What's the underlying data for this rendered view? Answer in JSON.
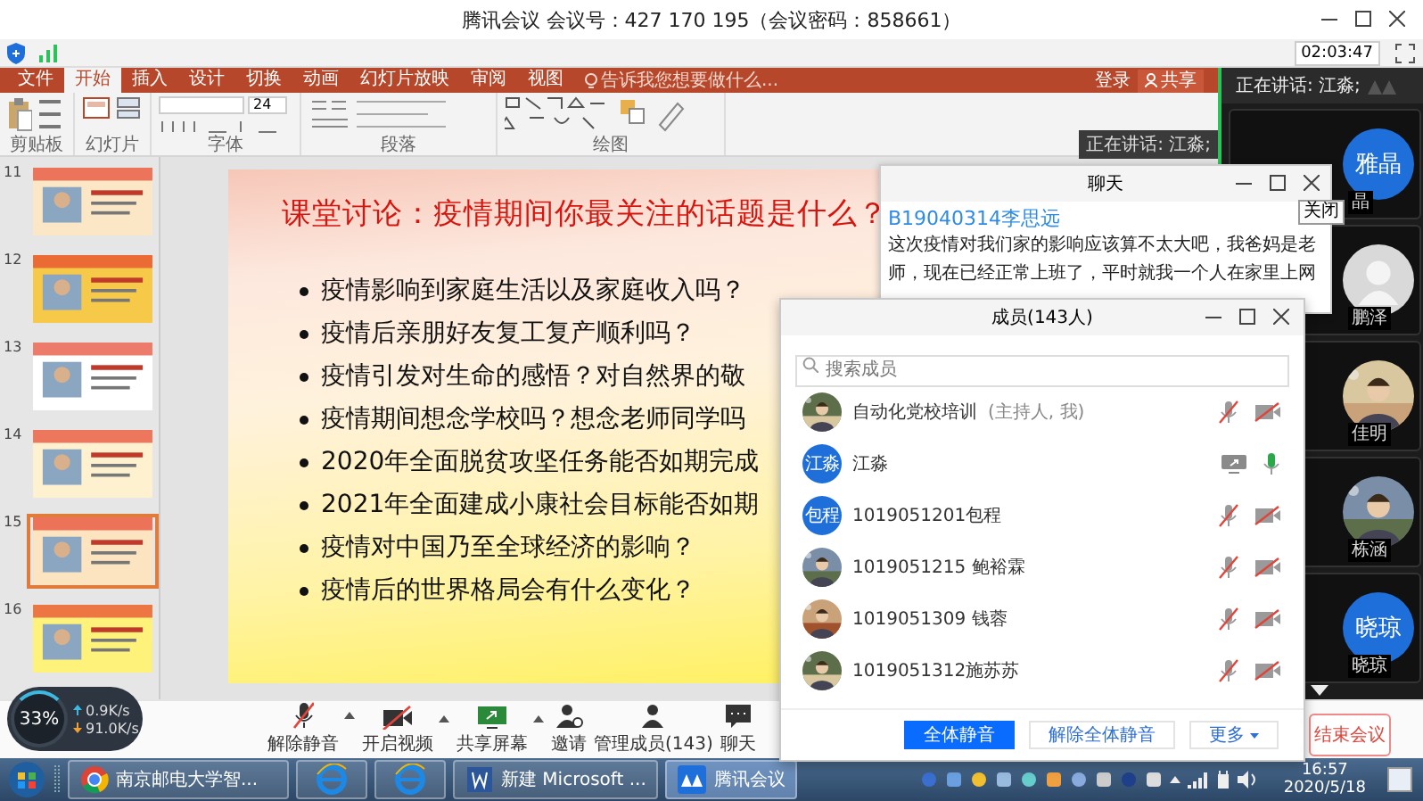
{
  "window": {
    "title": "腾讯会议 会议号：427 170 195（会议密码：858661）"
  },
  "timer": "02:03:47",
  "shared_screen": {
    "ribbon_tabs": [
      {
        "label": "文件",
        "selected": false
      },
      {
        "label": "开始",
        "selected": true
      },
      {
        "label": "插入",
        "selected": false
      },
      {
        "label": "设计",
        "selected": false
      },
      {
        "label": "切换",
        "selected": false
      },
      {
        "label": "动画",
        "selected": false
      },
      {
        "label": "幻灯片放映",
        "selected": false
      },
      {
        "label": "审阅",
        "selected": false
      },
      {
        "label": "视图",
        "selected": false
      }
    ],
    "ribbon_search": "告诉我您想要做什么...",
    "account": {
      "login": "登录",
      "share": "共享"
    },
    "font_size": "24",
    "ribbon_groups": [
      "剪贴板",
      "幻灯片",
      "字体",
      "段落",
      "绘图"
    ],
    "speaking_overlay": "正在讲话: 江淼;",
    "thumbnails": [
      {
        "number": "11",
        "selected": false
      },
      {
        "number": "12",
        "selected": false
      },
      {
        "number": "13",
        "selected": false
      },
      {
        "number": "14",
        "selected": false
      },
      {
        "number": "15",
        "selected": true
      },
      {
        "number": "16",
        "selected": false
      }
    ],
    "slide": {
      "title": "课堂讨论：疫情期间你最关注的话题是什么？",
      "bullets": [
        "疫情影响到家庭生活以及家庭收入吗？",
        "疫情后亲朋好友复工复产顺利吗？",
        "疫情引发对生命的感悟？对自然界的敬",
        "疫情期间想念学校吗？想念老师同学吗",
        "2020年全面脱贫攻坚任务能否如期完成",
        "2021年全面建成小康社会目标能否如期",
        "疫情对中国乃至全球经济的影响？",
        "疫情后的世界格局会有什么变化？"
      ]
    }
  },
  "participants": {
    "speaking": "正在讲话: 江淼;",
    "tiles": [
      {
        "name": "晶",
        "avatar": {
          "kind": "initials",
          "text": "雅晶"
        }
      },
      {
        "name": "鹏泽",
        "avatar": {
          "kind": "default"
        }
      },
      {
        "name": "佳明"
      },
      {
        "name": "栋涵"
      },
      {
        "name": "晓琼",
        "avatar": {
          "kind": "initials",
          "text": "晓琼"
        }
      }
    ]
  },
  "chat": {
    "title": "聊天",
    "tooltip": "关闭",
    "messages": [
      {
        "sender": "B19040314李思远",
        "text": "这次疫情对我们家的影响应该算不太大吧，我爸妈是老师，现在已经正常上班了，平时就我一个人在家里上网"
      }
    ]
  },
  "members": {
    "title": "成员(143人)",
    "search": {
      "placeholder": "搜索成员"
    },
    "rows": [
      {
        "name": "自动化党校培训",
        "role": "(主持人, 我)",
        "sharing": false,
        "mic_on": false,
        "camera_on": false
      },
      {
        "name": "江淼",
        "avatar": {
          "kind": "initials",
          "text": "江淼"
        },
        "sharing": true,
        "mic_on": true
      },
      {
        "name": "1019051201包程",
        "avatar": {
          "kind": "initials",
          "text": "包程"
        },
        "sharing": false,
        "mic_on": false,
        "camera_on": false
      },
      {
        "name": "1019051215 鲍裕霖",
        "sharing": false,
        "mic_on": false,
        "camera_on": false
      },
      {
        "name": "1019051309 钱蓉",
        "sharing": false,
        "mic_on": false,
        "camera_on": false
      },
      {
        "name": "1019051312施苏苏",
        "sharing": false,
        "mic_on": false,
        "camera_on": false
      }
    ],
    "buttons": [
      {
        "label": "全体静音",
        "kind": "primary"
      },
      {
        "label": "解除全体静音",
        "kind": "secondary"
      },
      {
        "label": "更多",
        "kind": "dropdown"
      }
    ]
  },
  "network": {
    "percent": "33%",
    "upload": "0.9K/s",
    "download": "91.0K/s"
  },
  "toolbar": {
    "buttons": [
      {
        "label": "解除静音",
        "kind": "mic_off",
        "caret": true
      },
      {
        "label": "开启视频",
        "kind": "video_off",
        "caret": true
      },
      {
        "label": "共享屏幕",
        "kind": "share",
        "caret": true
      },
      {
        "label": "邀请",
        "kind": "invite",
        "caret": false
      },
      {
        "label": "管理成员(143)",
        "kind": "members",
        "caret": false
      },
      {
        "label": "聊天",
        "kind": "chat",
        "caret": false
      }
    ],
    "end_button": "结束会议"
  },
  "taskbar": {
    "items": [
      {
        "kind": "chrome",
        "label": "南京邮电大学智...",
        "selected": false
      },
      {
        "kind": "ie",
        "selected": false
      },
      {
        "kind": "ie",
        "selected": false
      },
      {
        "kind": "word",
        "label": "新建 Microsoft ...",
        "selected": false
      },
      {
        "kind": "meeting",
        "label": "腾讯会议",
        "selected": true
      }
    ],
    "time": "16:57",
    "date": "2020/5/18"
  }
}
